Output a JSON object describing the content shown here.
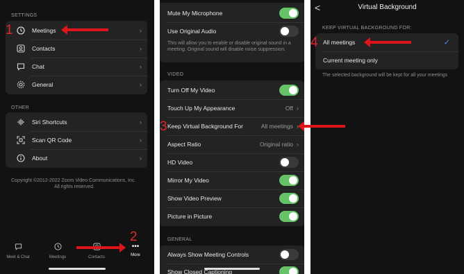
{
  "settings_panel": {
    "section_settings": "SETTINGS",
    "items": [
      {
        "label": "Meetings",
        "icon": "clock-icon"
      },
      {
        "label": "Contacts",
        "icon": "contacts-icon"
      },
      {
        "label": "Chat",
        "icon": "chat-icon"
      },
      {
        "label": "General",
        "icon": "gear-icon"
      }
    ],
    "section_other": "OTHER",
    "other_items": [
      {
        "label": "Siri Shortcuts",
        "icon": "waveform-icon"
      },
      {
        "label": "Scan QR Code",
        "icon": "qr-scan-icon"
      },
      {
        "label": "About",
        "icon": "info-icon"
      }
    ],
    "copyright_line1": "Copyright ©2012-2022 Zoom Video Communications, Inc.",
    "copyright_line2": "All rights reserved.",
    "tabs": [
      {
        "label": "Meet & Chat"
      },
      {
        "label": "Meetings"
      },
      {
        "label": "Contacts"
      },
      {
        "label": "More"
      }
    ]
  },
  "meetings_panel": {
    "mute_mic": "Mute My Microphone",
    "original_audio": "Use Original Audio",
    "original_audio_desc": "This will allow you to enable or disable original sound in a meeting. Original sound will disable noise suppression.",
    "section_video": "VIDEO",
    "turn_off_video": "Turn Off My Video",
    "touch_up": "Touch Up My Appearance",
    "touch_up_value": "Off",
    "keep_vbg": "Keep Virtual Background For",
    "keep_vbg_value": "All meetings",
    "aspect_ratio": "Aspect Ratio",
    "aspect_ratio_value": "Original ratio",
    "hd_video": "HD Video",
    "mirror_video": "Mirror My Video",
    "show_preview": "Show Video Preview",
    "pip": "Picture in Picture",
    "section_general": "GENERAL",
    "always_show_controls": "Always Show Meeting Controls",
    "show_cc": "Show Closed Captioning"
  },
  "vbg_panel": {
    "back": "<",
    "title": "Virtual Background",
    "section": "KEEP VIRTUAL BACKGROUND FOR:",
    "option_all": "All meetings",
    "option_current": "Current meeting only",
    "note": "The selected background will be kept for all your meetings",
    "check": "✓"
  },
  "annotations": {
    "n1": "1",
    "n2": "2",
    "n3": "3",
    "n4": "4"
  },
  "colors": {
    "toggle_on": "#66c266",
    "annotation_red": "#e0141b",
    "checkmark_blue": "#4a8cff"
  }
}
